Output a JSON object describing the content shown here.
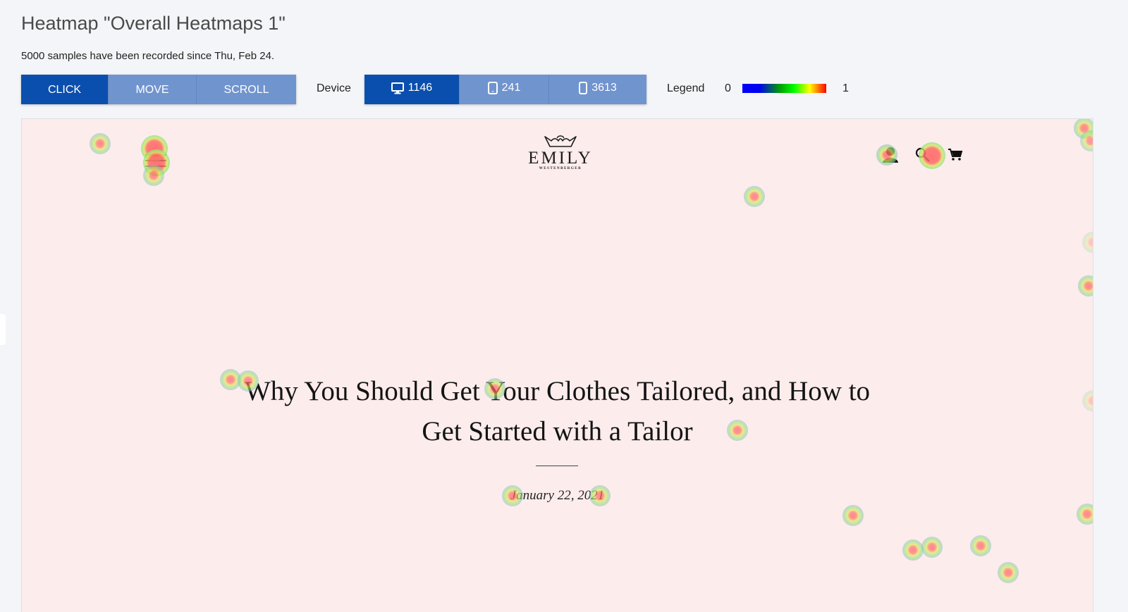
{
  "header": {
    "title": "Heatmap \"Overall Heatmaps 1\"",
    "subtitle": "5000 samples have been recorded since Thu, Feb 24."
  },
  "modes": [
    {
      "label": "CLICK",
      "active": true
    },
    {
      "label": "MOVE",
      "active": false
    },
    {
      "label": "SCROLL",
      "active": false
    }
  ],
  "device": {
    "label": "Device",
    "options": [
      {
        "icon": "desktop-icon",
        "count": "1146",
        "active": true
      },
      {
        "icon": "tablet-icon",
        "count": "241",
        "active": false
      },
      {
        "icon": "mobile-icon",
        "count": "3613",
        "active": false
      }
    ]
  },
  "legend": {
    "label": "Legend",
    "min": "0",
    "max": "1",
    "colors": [
      "#0000ff",
      "#00ff00",
      "#ffff00",
      "#ff0000"
    ]
  },
  "site": {
    "logo_name": "EMILY",
    "logo_sub": "WESTENBERGER",
    "article_title_line1": "Why You Should Get Your Clothes Tailored, and How to",
    "article_title_line2": "Get Started with a Tailor",
    "article_date": "January 22, 2021",
    "background": "#fcecec"
  },
  "heatmap": {
    "points_note": "click hotspot positions as fractions of the page viewport (x, y)",
    "points": [
      {
        "x": 0.073,
        "y": 0.05,
        "intensity": 0.8
      },
      {
        "x": 0.124,
        "y": 0.06,
        "intensity": 1.0
      },
      {
        "x": 0.126,
        "y": 0.088,
        "intensity": 1.0
      },
      {
        "x": 0.123,
        "y": 0.114,
        "intensity": 0.8
      },
      {
        "x": 0.808,
        "y": 0.073,
        "intensity": 0.9
      },
      {
        "x": 0.85,
        "y": 0.074,
        "intensity": 1.0
      },
      {
        "x": 0.684,
        "y": 0.157,
        "intensity": 0.8
      },
      {
        "x": 0.992,
        "y": 0.018,
        "intensity": 0.8
      },
      {
        "x": 0.998,
        "y": 0.044,
        "intensity": 0.7
      },
      {
        "x": 1.0,
        "y": 0.25,
        "intensity": 0.3
      },
      {
        "x": 0.996,
        "y": 0.339,
        "intensity": 0.8
      },
      {
        "x": 1.0,
        "y": 0.571,
        "intensity": 0.3
      },
      {
        "x": 0.195,
        "y": 0.529,
        "intensity": 0.8
      },
      {
        "x": 0.211,
        "y": 0.532,
        "intensity": 0.8
      },
      {
        "x": 0.442,
        "y": 0.547,
        "intensity": 0.8
      },
      {
        "x": 0.668,
        "y": 0.631,
        "intensity": 0.8
      },
      {
        "x": 0.458,
        "y": 0.764,
        "intensity": 0.8
      },
      {
        "x": 0.54,
        "y": 0.764,
        "intensity": 0.8
      },
      {
        "x": 0.776,
        "y": 0.804,
        "intensity": 0.8
      },
      {
        "x": 0.995,
        "y": 0.801,
        "intensity": 0.8
      },
      {
        "x": 0.832,
        "y": 0.874,
        "intensity": 0.8
      },
      {
        "x": 0.85,
        "y": 0.869,
        "intensity": 0.8
      },
      {
        "x": 0.895,
        "y": 0.866,
        "intensity": 0.8
      },
      {
        "x": 0.921,
        "y": 0.92,
        "intensity": 0.8
      }
    ]
  }
}
